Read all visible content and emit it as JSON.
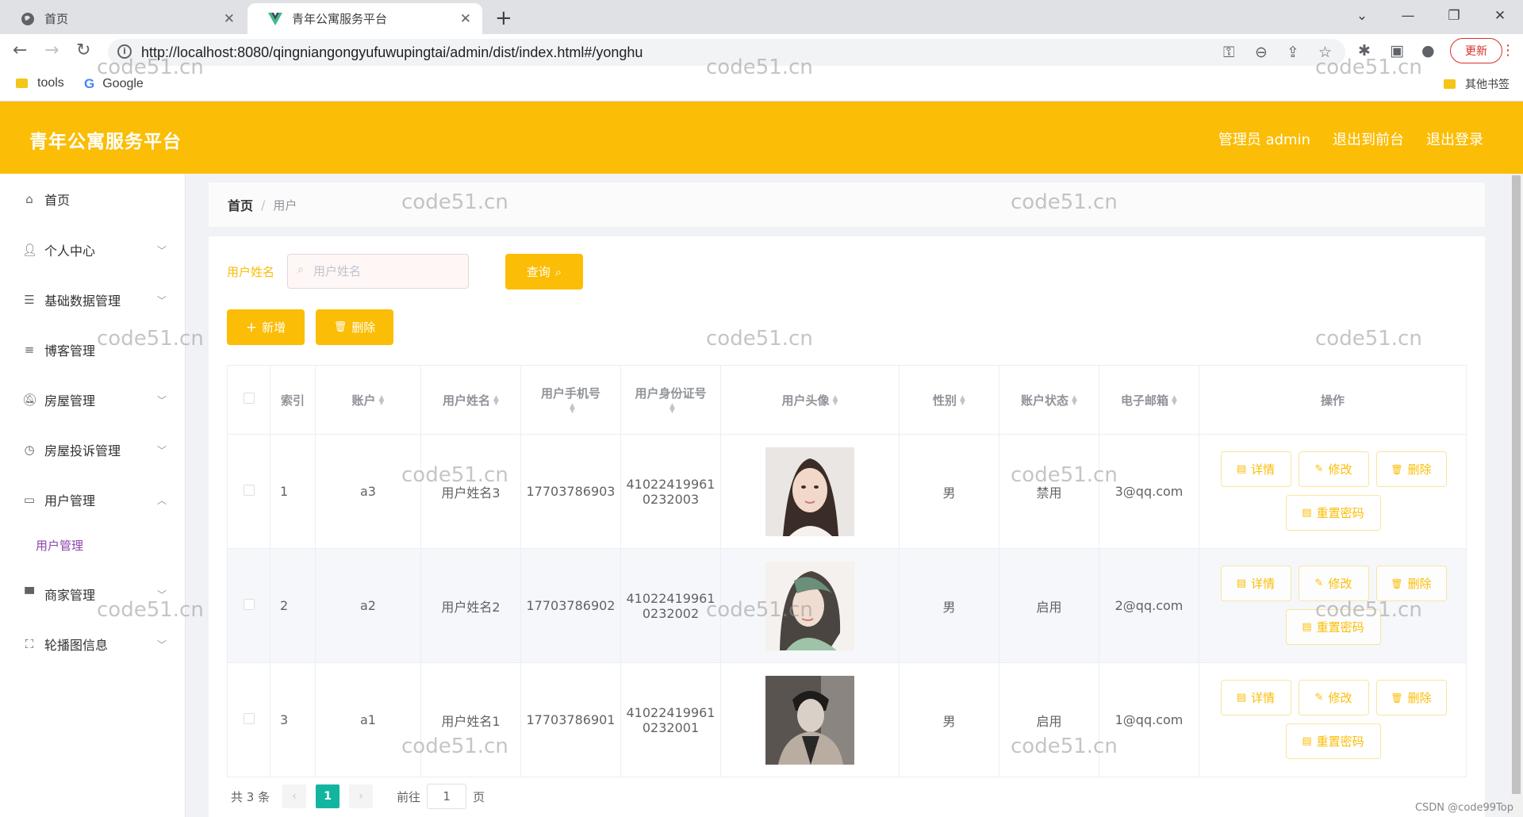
{
  "browser": {
    "tabs": [
      {
        "title": "首页"
      },
      {
        "title": "青年公寓服务平台"
      }
    ],
    "url": "http://localhost:8080/qingniangongyufuwupingtai/admin/dist/index.html#/yonghu",
    "update_label": "更新",
    "bookmarks": [
      {
        "label": "tools"
      },
      {
        "label": "Google"
      }
    ],
    "other_bookmarks": "其他书签"
  },
  "header": {
    "title": "青年公寓服务平台",
    "admin_label": "管理员 admin",
    "back_to_front": "退出到前台",
    "logout": "退出登录"
  },
  "sidebar": {
    "items": [
      {
        "label": "首页",
        "icon": "home-icon"
      },
      {
        "label": "个人中心",
        "icon": "user-icon"
      },
      {
        "label": "基础数据管理",
        "icon": "list-icon"
      },
      {
        "label": "博客管理",
        "icon": "menu-icon"
      },
      {
        "label": "房屋管理",
        "icon": "bell-off-icon"
      },
      {
        "label": "房屋投诉管理",
        "icon": "clock-icon"
      },
      {
        "label": "用户管理",
        "icon": "chat-icon"
      },
      {
        "label": "商家管理",
        "icon": "shop-icon"
      },
      {
        "label": "轮播图信息",
        "icon": "fullscreen-icon"
      }
    ],
    "active_sub": "用户管理"
  },
  "breadcrumb": {
    "home": "首页",
    "separator": "/",
    "current": "用户"
  },
  "search": {
    "label": "用户姓名",
    "placeholder": "用户姓名",
    "value": "",
    "query_button": "查询"
  },
  "actions": {
    "add": "新增",
    "delete": "删除"
  },
  "table": {
    "columns": [
      "索引",
      "账户",
      "用户姓名",
      "用户手机号",
      "用户身份证号",
      "用户头像",
      "性别",
      "账户状态",
      "电子邮箱",
      "操作"
    ],
    "rows": [
      {
        "index": "1",
        "account": "a3",
        "name": "用户姓名3",
        "phone": "17703786903",
        "id_line1": "41022419961",
        "id_line2": "0232003",
        "gender": "男",
        "status": "禁用",
        "email": "3@qq.com"
      },
      {
        "index": "2",
        "account": "a2",
        "name": "用户姓名2",
        "phone": "17703786902",
        "id_line1": "41022419961",
        "id_line2": "0232002",
        "gender": "男",
        "status": "启用",
        "email": "2@qq.com"
      },
      {
        "index": "3",
        "account": "a1",
        "name": "用户姓名1",
        "phone": "17703786901",
        "id_line1": "41022419961",
        "id_line2": "0232001",
        "gender": "男",
        "status": "启用",
        "email": "1@qq.com"
      }
    ],
    "row_actions": {
      "detail": "详情",
      "edit": "修改",
      "delete": "删除",
      "reset": "重置密码"
    }
  },
  "pagination": {
    "total": "共 3 条",
    "current_page": "1",
    "goto_prefix": "前往",
    "goto_value": "1",
    "goto_suffix": "页"
  },
  "watermark": "code51.cn",
  "footer_credit": "CSDN @code99Top",
  "colors": {
    "brand": "#fbbd05",
    "page_active": "#13b5a0",
    "sub_active": "#8e44ad"
  }
}
